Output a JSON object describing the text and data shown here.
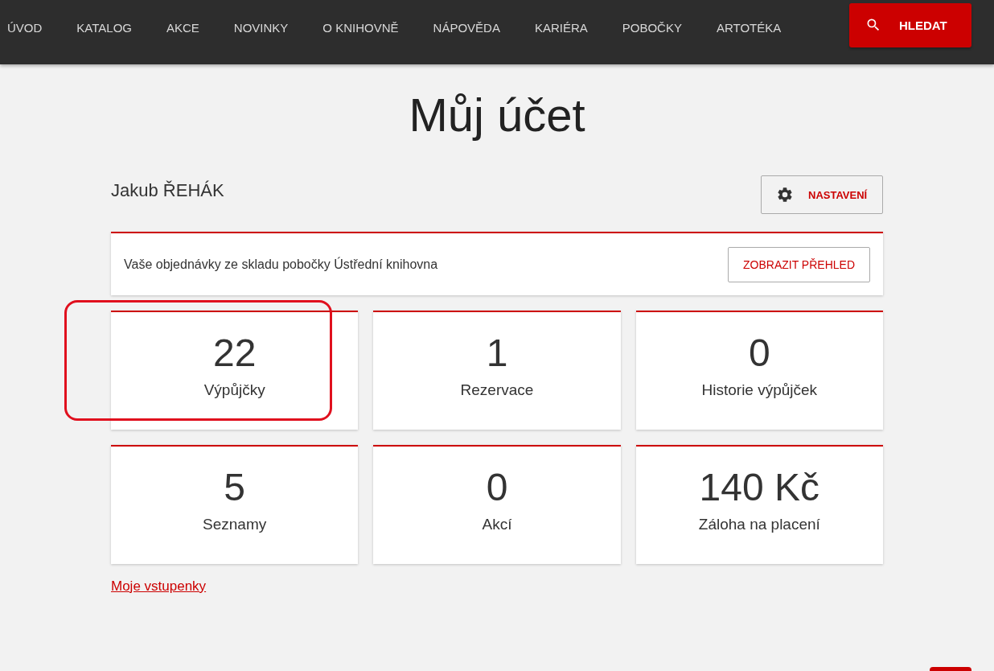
{
  "nav": {
    "items": [
      "ÚVOD",
      "KATALOG",
      "AKCE",
      "NOVINKY",
      "O KNIHOVNĚ",
      "NÁPOVĚDA",
      "KARIÉRA",
      "POBOČKY",
      "ARTOTÉKA"
    ],
    "search_button": "HLEDAT"
  },
  "title": "Můj účet",
  "user": {
    "name": "Jakub ŘEHÁK",
    "settings_button": "NASTAVENÍ"
  },
  "orders": {
    "text": "Vaše objednávky ze skladu pobočky Ústřední knihovna",
    "button": "ZOBRAZIT PŘEHLED"
  },
  "tiles": [
    {
      "value": "22",
      "label": "Výpůjčky",
      "highlighted": true
    },
    {
      "value": "1",
      "label": "Rezervace",
      "highlighted": false
    },
    {
      "value": "0",
      "label": "Historie výpůjček",
      "highlighted": false
    },
    {
      "value": "5",
      "label": "Seznamy",
      "highlighted": false
    },
    {
      "value": "0",
      "label": "Akcí",
      "highlighted": false
    },
    {
      "value": "140 Kč",
      "label": "Záloha na placení",
      "highlighted": false
    }
  ],
  "link": "Moje vstupenky"
}
